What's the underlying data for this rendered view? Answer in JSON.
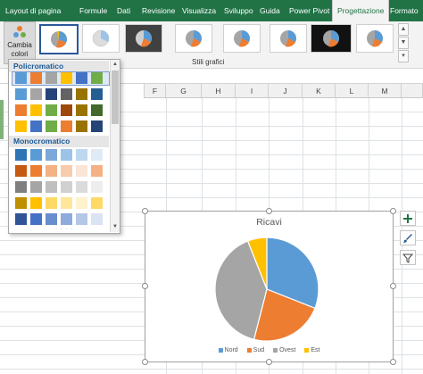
{
  "ribbon": {
    "tabs": [
      {
        "label": "Layout di pagina",
        "active": false
      },
      {
        "label": "Formule",
        "active": false
      },
      {
        "label": "Dati",
        "active": false
      },
      {
        "label": "Revisione",
        "active": false
      },
      {
        "label": "Visualizza",
        "active": false
      },
      {
        "label": "Sviluppo",
        "active": false
      },
      {
        "label": "Guida",
        "active": false
      },
      {
        "label": "Power Pivot",
        "active": false
      },
      {
        "label": "Progettazione",
        "active": true
      },
      {
        "label": "Formato",
        "active": false
      }
    ],
    "change_colors": {
      "line1": "Cambia",
      "line2": "colori",
      "icon": "palette-icon"
    },
    "gallery_group_label": "Stili grafici",
    "gallery_styles": 9
  },
  "sheet": {
    "columns": [
      "F",
      "G",
      "H",
      "I",
      "J",
      "K",
      "L",
      "M"
    ],
    "colors": {
      "gridline": "#dde2e6",
      "header_bg": "#f0f0f0",
      "excel_green": "#217346"
    }
  },
  "color_menu": {
    "section_colorful": "Policromatico",
    "section_monochrome": "Monocromatico",
    "colorful_rows": [
      [
        "#5b9bd5",
        "#ed7d31",
        "#a5a5a5",
        "#ffc000",
        "#4472c4",
        "#70ad47"
      ],
      [
        "#5b9bd5",
        "#a5a5a5",
        "#264478",
        "#636363",
        "#997300",
        "#255e91"
      ],
      [
        "#ed7d31",
        "#ffc000",
        "#70ad47",
        "#9e480e",
        "#997300",
        "#43682b"
      ],
      [
        "#ffc000",
        "#4472c4",
        "#70ad47",
        "#ed7d31",
        "#997300",
        "#264478"
      ]
    ],
    "monochrome_rows": [
      [
        "#2e75b6",
        "#5b9bd5",
        "#7ba7d9",
        "#9dc3e6",
        "#bdd7ee",
        "#deebf7"
      ],
      [
        "#c55a11",
        "#ed7d31",
        "#f4b183",
        "#f8cbad",
        "#fbe5d6",
        "#f4b183"
      ],
      [
        "#7f7f7f",
        "#a5a5a5",
        "#bfbfbf",
        "#d0d0d0",
        "#dbdbdb",
        "#ededed"
      ],
      [
        "#bf9000",
        "#ffc000",
        "#ffd966",
        "#ffe699",
        "#fff2cc",
        "#ffd966"
      ],
      [
        "#2f5597",
        "#4472c4",
        "#698ed0",
        "#8faadc",
        "#b4c7e7",
        "#dae3f3"
      ]
    ],
    "selected_row": 0
  },
  "chart": {
    "title": "Ricavi",
    "side_buttons": [
      "plus-icon",
      "brush-icon",
      "filter-icon"
    ]
  },
  "chart_data": {
    "type": "pie",
    "title": "Ricavi",
    "categories": [
      "Nord",
      "Sud",
      "Ovest",
      "Est"
    ],
    "values": [
      31,
      23,
      40,
      6
    ],
    "colors": [
      "#5b9bd5",
      "#ed7d31",
      "#a5a5a5",
      "#ffc000"
    ],
    "legend": "bottom"
  }
}
